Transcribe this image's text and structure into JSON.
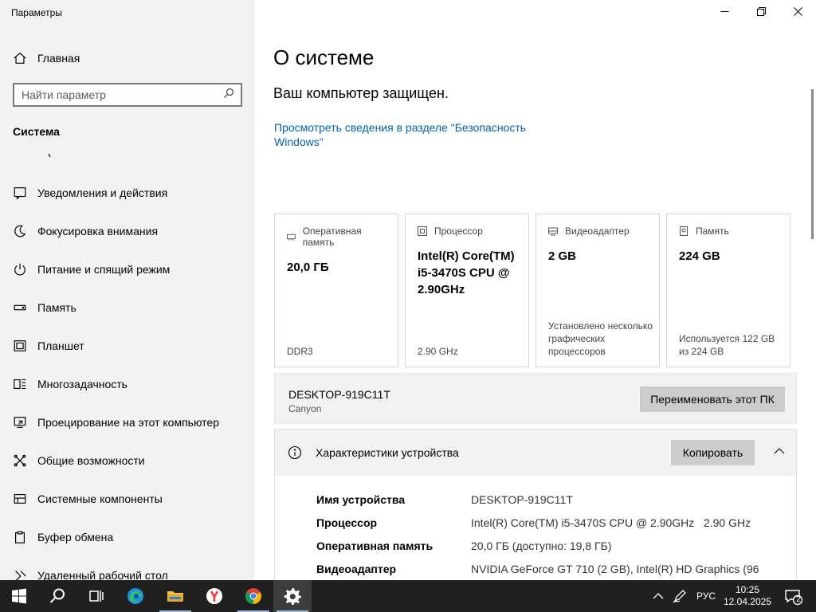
{
  "window": {
    "title": "Параметры",
    "controls": {
      "minimize": "minimize-icon",
      "maximize": "restore-icon",
      "close": "close-icon"
    }
  },
  "sidebar": {
    "home_label": "Главная",
    "search": {
      "placeholder": "Найти параметр",
      "value": ""
    },
    "section_title": "Система",
    "items": [
      {
        "label": "Уведомления и действия",
        "icon": "notifications-icon"
      },
      {
        "label": "Фокусировка внимания",
        "icon": "focus-assist-icon"
      },
      {
        "label": "Питание и спящий режим",
        "icon": "power-icon"
      },
      {
        "label": "Память",
        "icon": "storage-icon"
      },
      {
        "label": "Планшет",
        "icon": "tablet-icon"
      },
      {
        "label": "Многозадачность",
        "icon": "multitasking-icon"
      },
      {
        "label": "Проецирование на этот компьютер",
        "icon": "projecting-icon"
      },
      {
        "label": "Общие возможности",
        "icon": "shared-experiences-icon"
      },
      {
        "label": "Системные компоненты",
        "icon": "system-components-icon"
      },
      {
        "label": "Буфер обмена",
        "icon": "clipboard-icon"
      },
      {
        "label": "Удаленный рабочий стол",
        "icon": "remote-desktop-icon"
      }
    ]
  },
  "main": {
    "title": "О системе",
    "protected_text": "Ваш компьютер защищен.",
    "security_link": "Просмотреть сведения в разделе \"Безопасность Windows\"",
    "cards": [
      {
        "label": "Оперативная память",
        "value": "20,0 ГБ",
        "footer": "DDR3",
        "icon": "ram-icon"
      },
      {
        "label": "Процессор",
        "value": "Intel(R) Core(TM) i5-3470S CPU @ 2.90GHz",
        "footer": "2.90 GHz",
        "icon": "processor-icon"
      },
      {
        "label": "Видеоадаптер",
        "value": "2 GB",
        "footer": "Установлено несколько графических процессоров",
        "icon": "video-adapter-icon"
      },
      {
        "label": "Память",
        "value": "224 GB",
        "footer": "Используется 122 GB из 224 GB",
        "icon": "storage-icon"
      }
    ],
    "pc": {
      "name": "DESKTOP-919C11T",
      "model": "Canyon",
      "rename_button": "Переименовать этот ПК"
    },
    "specs": {
      "title": "Характеристики устройства",
      "copy_button": "Копировать",
      "rows": [
        {
          "key": "Имя устройства",
          "value": "DESKTOP-919C11T"
        },
        {
          "key": "Процессор",
          "value": "Intel(R) Core(TM) i5-3470S CPU @ 2.90GHz   2.90 GHz"
        },
        {
          "key": "Оперативная память",
          "value": "20,0 ГБ (доступно: 19,8 ГБ)"
        },
        {
          "key": "Видеоадаптер",
          "value": "NVIDIA GeForce GT 710 (2 GB), Intel(R) HD Graphics (96"
        }
      ]
    }
  },
  "taskbar": {
    "apps": [
      "windows-start-icon",
      "search-icon",
      "task-view-icon",
      "edge-icon",
      "file-explorer-icon",
      "yandex-browser-icon",
      "chrome-icon",
      "settings-icon"
    ],
    "active_app": "settings-icon",
    "language": "РУС",
    "time": "10:25",
    "date": "12.04.2025",
    "notification_count": "2"
  },
  "colors": {
    "sidebar_bg": "#f2f2f2",
    "link": "#0063b1",
    "button_bg": "#cccccc",
    "taskbar_bg": "#202020"
  }
}
